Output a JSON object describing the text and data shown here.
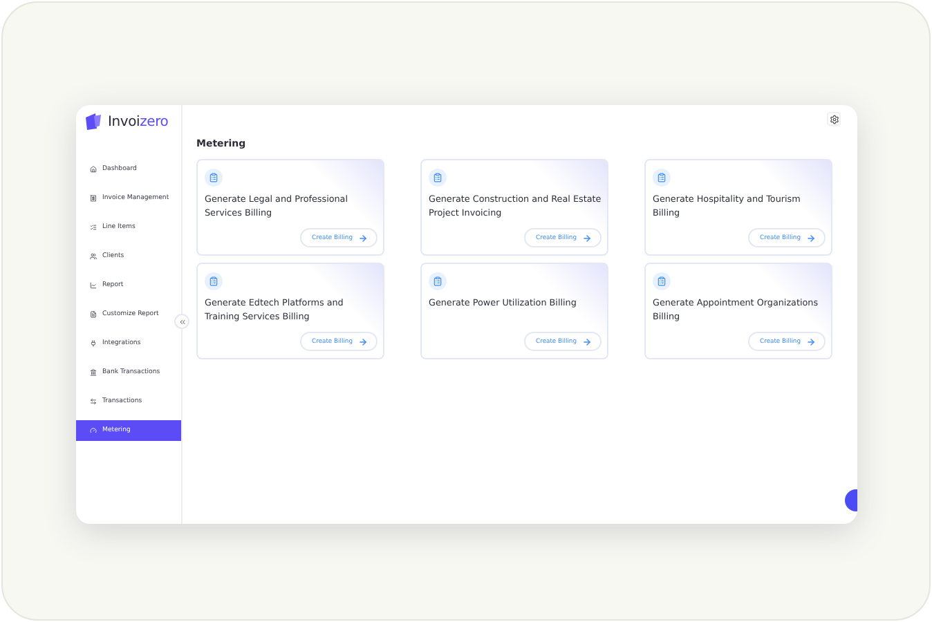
{
  "logo": {
    "text": "Invoi",
    "accent": "zero"
  },
  "sidebar": {
    "items": [
      {
        "label": "Dashboard",
        "selected": false
      },
      {
        "label": "Invoice Management",
        "selected": false
      },
      {
        "label": "Line Items",
        "selected": false
      },
      {
        "label": "Clients",
        "selected": false
      },
      {
        "label": "Report",
        "selected": false
      },
      {
        "label": "Customize Report",
        "selected": false
      },
      {
        "label": "Integrations",
        "selected": false
      },
      {
        "label": "Bank Transactions",
        "selected": false
      },
      {
        "label": "Transactions",
        "selected": false
      },
      {
        "label": "Metering",
        "selected": true
      }
    ]
  },
  "page": {
    "title": "Metering"
  },
  "cards": [
    {
      "title": "Generate Legal and Professional Services Billing",
      "action": "Create Billing"
    },
    {
      "title": "Generate Construction and Real Estate Project Invoicing",
      "action": "Create Billing"
    },
    {
      "title": "Generate Hospitality and Tourism Billing",
      "action": "Create Billing"
    },
    {
      "title": "Generate Edtech Platforms and Training Services Billing",
      "action": "Create Billing"
    },
    {
      "title": "Generate Power Utilization Billing",
      "action": "Create Billing"
    },
    {
      "title": "Generate Appointment Organizations Billing",
      "action": "Create Billing"
    }
  ]
}
